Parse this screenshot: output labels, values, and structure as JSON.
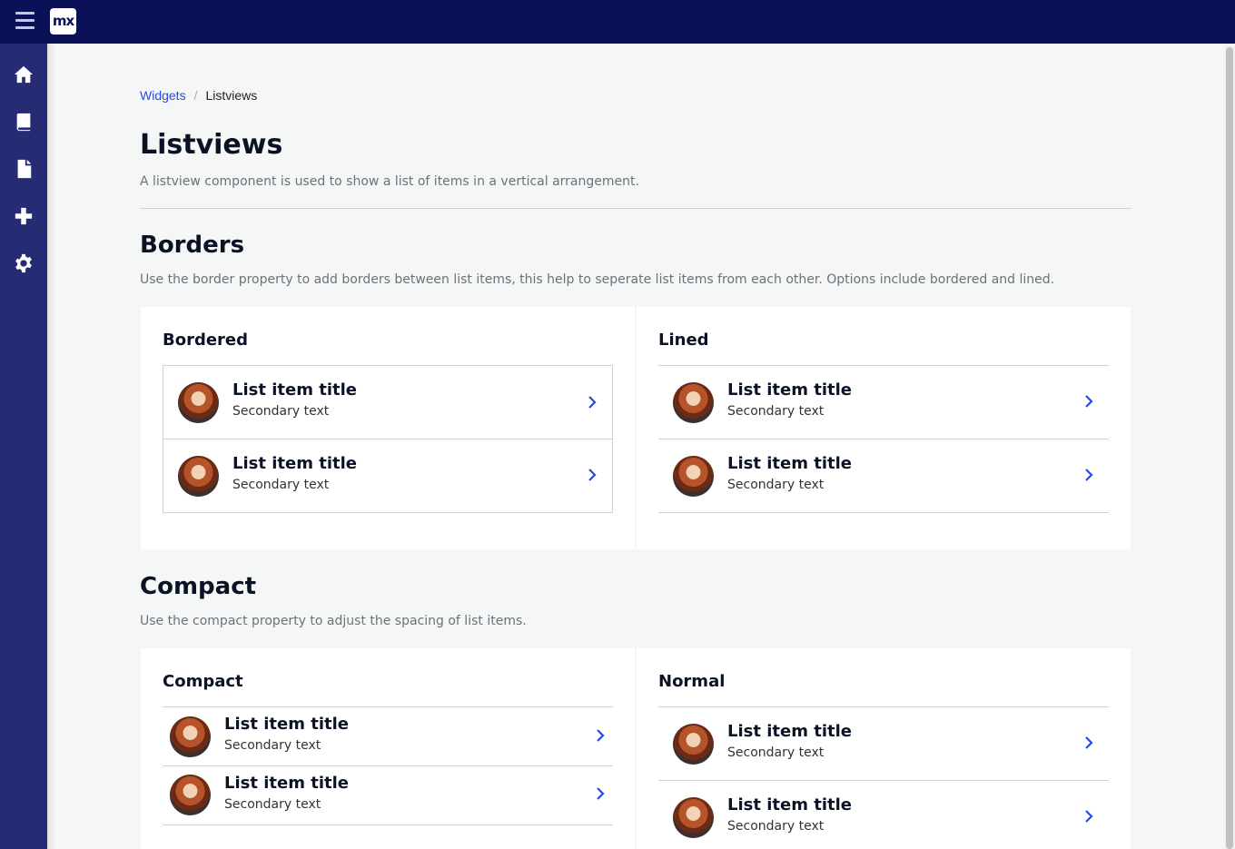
{
  "app": {
    "logo_text": "mx"
  },
  "sidebar": {
    "items": [
      {
        "icon": "home-icon"
      },
      {
        "icon": "book-icon"
      },
      {
        "icon": "file-icon"
      },
      {
        "icon": "plus-icon"
      },
      {
        "icon": "gear-icon"
      }
    ]
  },
  "breadcrumb": {
    "parent": "Widgets",
    "separator": "/",
    "current": "Listviews"
  },
  "page": {
    "title": "Listviews",
    "description": "A listview component is used to show a list of items in a vertical arrangement."
  },
  "sections": {
    "borders": {
      "title": "Borders",
      "description": "Use the border property to add borders between list items, this help to seperate list items from each other. Options include bordered and lined.",
      "left_card_title": "Bordered",
      "right_card_title": "Lined"
    },
    "compact": {
      "title": "Compact",
      "description": "Use the compact property to adjust the spacing of list items.",
      "left_card_title": "Compact",
      "right_card_title": "Normal"
    }
  },
  "list_item": {
    "title": "List item title",
    "secondary": "Secondary text"
  },
  "colors": {
    "topbar": "#0a1157",
    "sidebar": "#252c73",
    "accent": "#264ae5"
  }
}
